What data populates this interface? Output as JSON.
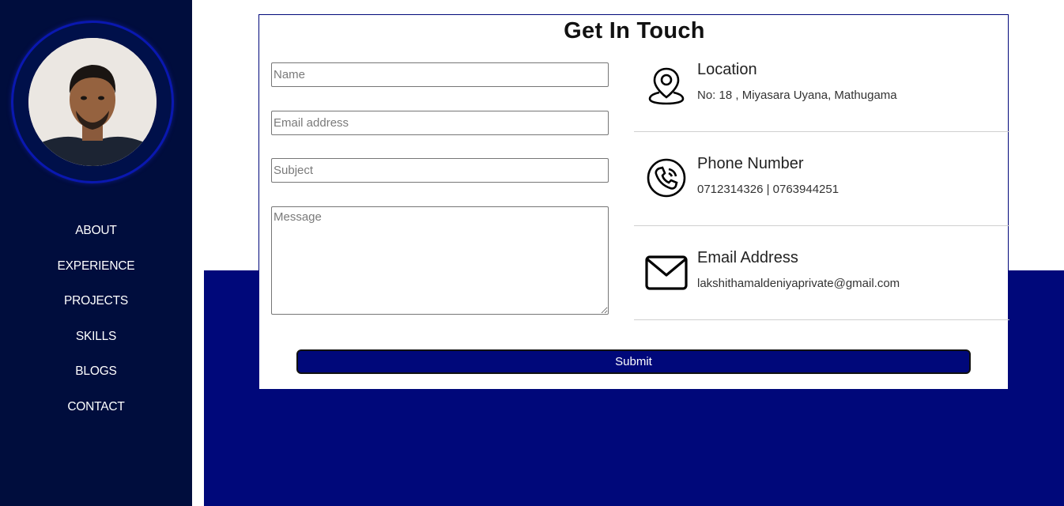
{
  "nav": {
    "items": [
      {
        "label": "ABOUT"
      },
      {
        "label": "EXPERIENCE"
      },
      {
        "label": "PROJECTS"
      },
      {
        "label": "SKILLS"
      },
      {
        "label": "BLOGS"
      },
      {
        "label": "CONTACT"
      }
    ]
  },
  "contact": {
    "title": "Get In Touch",
    "form": {
      "name_placeholder": "Name",
      "email_placeholder": "Email address",
      "subject_placeholder": "Subject",
      "message_placeholder": "Message",
      "submit_label": "Submit"
    },
    "info": [
      {
        "icon": "location-pin-icon",
        "heading": "Location",
        "text": "No: 18 , Miyasara Uyana, Mathugama"
      },
      {
        "icon": "phone-icon",
        "heading": "Phone Number",
        "text": "0712314326 | 0763944251"
      },
      {
        "icon": "mail-icon",
        "heading": "Email Address",
        "text": "lakshithamaldeniyaprivate@gmail.com"
      }
    ]
  },
  "colors": {
    "sidebar_bg": "#000d3d",
    "accent_blue": "#00087a",
    "ring_blue": "#0a18b0"
  }
}
